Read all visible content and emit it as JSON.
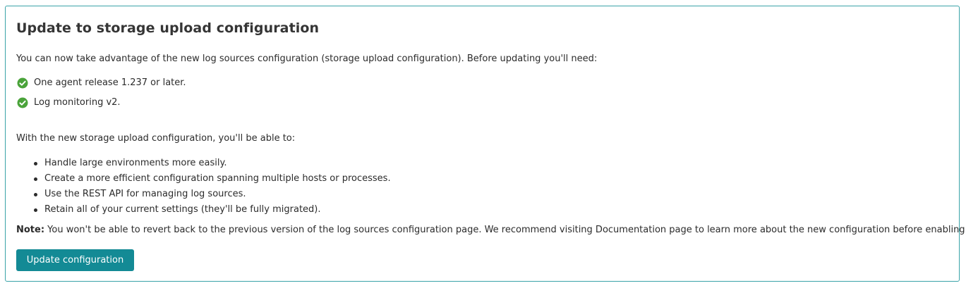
{
  "panel": {
    "title": "Update to storage upload configuration",
    "intro": "You can now take advantage of the new log sources configuration (storage upload configuration). Before updating you'll need:",
    "requirements": [
      {
        "icon": "check-circle-icon",
        "label": "One agent release 1.237 or later."
      },
      {
        "icon": "check-circle-icon",
        "label": "Log monitoring v2."
      }
    ],
    "benefits_intro": "With the new storage upload configuration, you'll be able to:",
    "benefits": [
      "Handle large environments more easily.",
      "Create a more efficient configuration spanning multiple hosts or processes.",
      "Use the REST API for managing log sources.",
      "Retain all of your current settings (they'll be fully migrated)."
    ],
    "note_label": "Note:",
    "note_text": " You won't be able to revert back to the previous version of the log sources configuration page. We recommend visiting Documentation page to learn more about the new configuration before enabling it.",
    "button_label": "Update configuration"
  },
  "colors": {
    "border": "#3aa3a8",
    "check": "#4aa33a",
    "button": "#138a95"
  }
}
